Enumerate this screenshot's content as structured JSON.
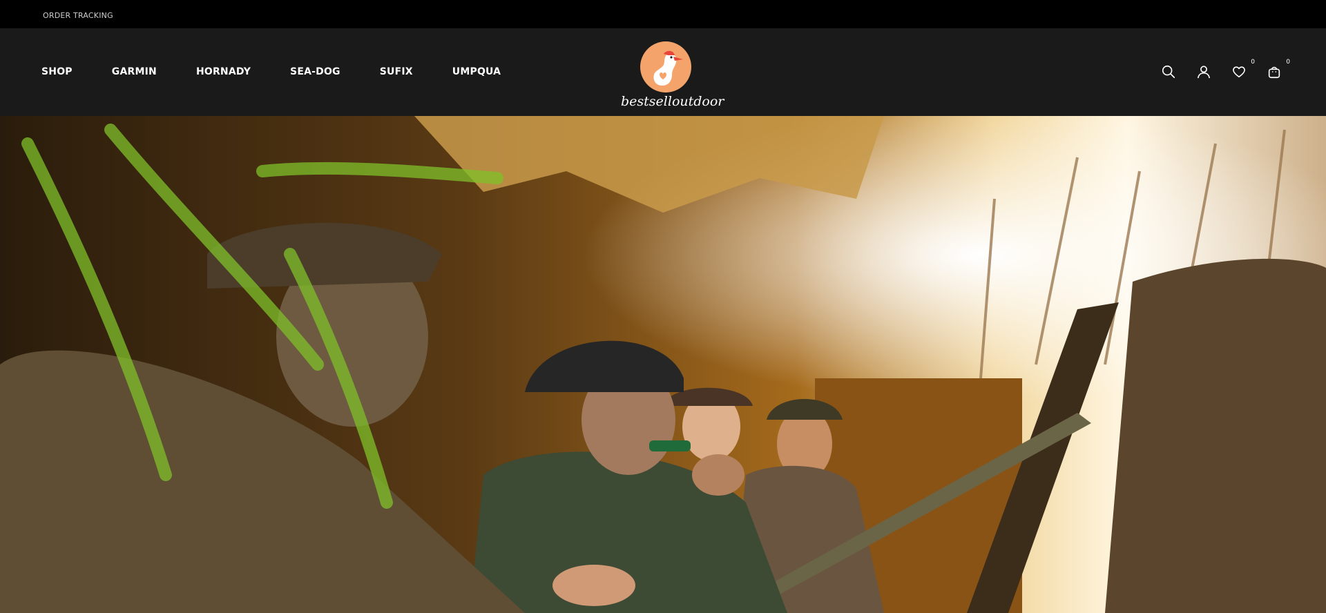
{
  "topbar": {
    "order_tracking": "ORDER TRACKING"
  },
  "nav": {
    "items": [
      "SHOP",
      "GARMIN",
      "HORNADY",
      "SEA-DOG",
      "SUFIX",
      "UMPQUA"
    ]
  },
  "logo": {
    "text": "bestselloutdoor"
  },
  "header_icons": {
    "search": "search-icon",
    "account": "user-icon",
    "wishlist": "heart-icon",
    "wishlist_count": "0",
    "cart": "bag-icon",
    "cart_count": "0"
  },
  "colors": {
    "topbar": "#000000",
    "header": "#1a1a1a",
    "logo_accent": "#f4a46a"
  },
  "hero": {
    "image": "hunters-in-duck-blind-photo"
  }
}
